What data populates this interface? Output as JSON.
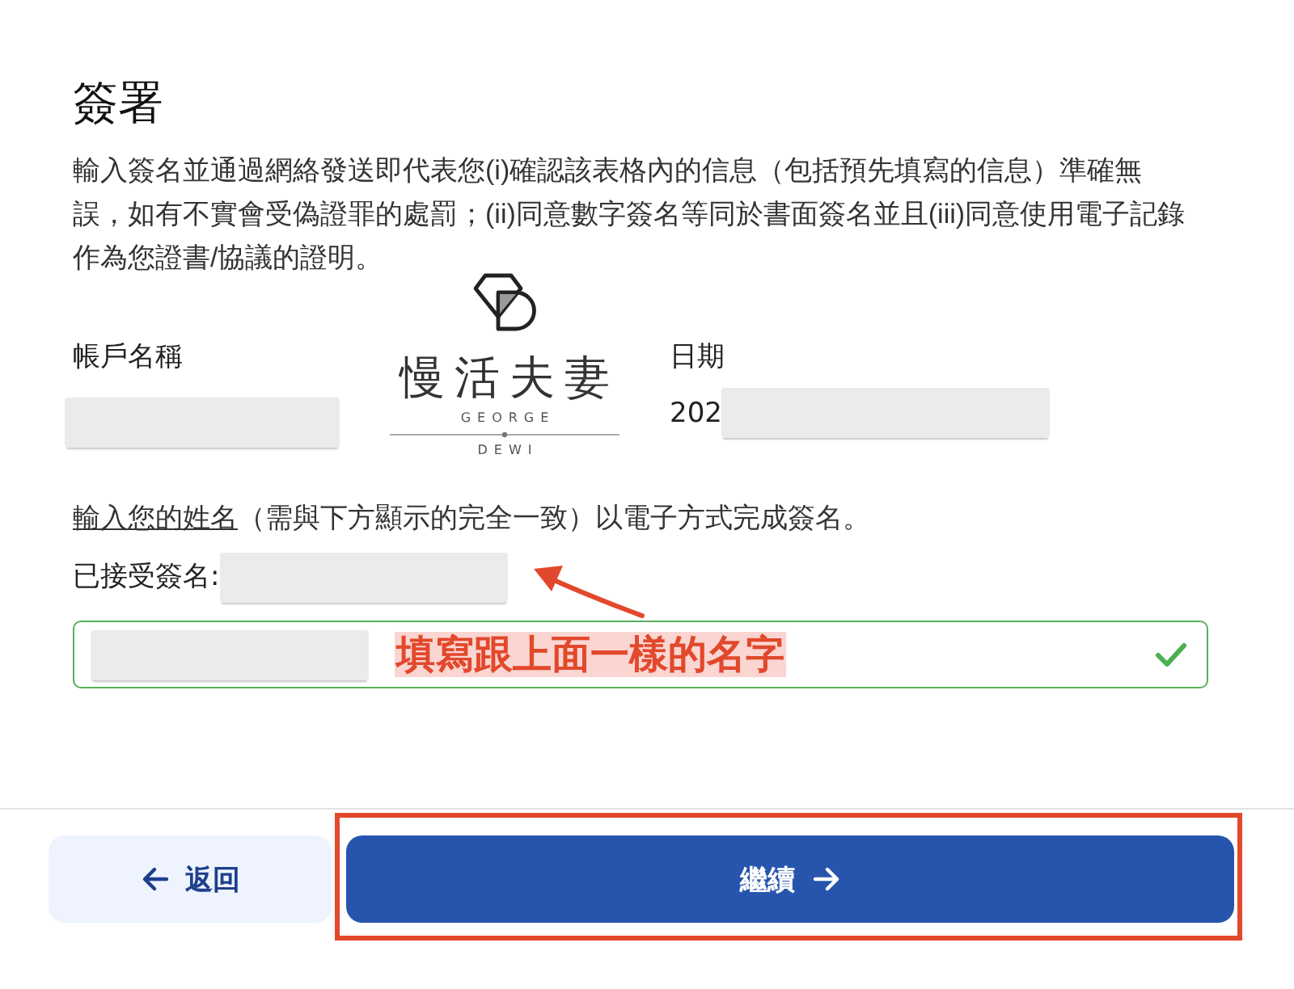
{
  "heading": "簽署",
  "declaration": "輸入簽名並通過網絡發送即代表您(i)確認該表格內的信息（包括預先填寫的信息）準確無誤，如有不實會受偽證罪的處罰；(ii)同意數字簽名等同於書面簽名並且(iii)同意使用電子記錄作為您證書/協議的證明。",
  "account": {
    "label": "帳戶名稱",
    "redacted": true
  },
  "logo": {
    "name": "慢活夫妻",
    "line_1": "GEORGE",
    "line_2": "DEWI"
  },
  "date": {
    "label": "日期",
    "value": "202",
    "redacted": true
  },
  "instruction": {
    "link": "輸入您的姓名",
    "text": "（需與下方顯示的完全一致）以電子方式完成簽名。"
  },
  "accepted_signature": {
    "label": "已接受簽名:",
    "redacted": true,
    "pointer_arrow": true
  },
  "signature_field": {
    "redacted": true,
    "note": "填寫跟上面一樣的名字",
    "valid": true
  },
  "buttons": [
    {
      "label": "返回",
      "kind": "secondary",
      "highlighted": false
    },
    {
      "label": "繼續",
      "kind": "primary",
      "highlighted": true
    }
  ]
}
